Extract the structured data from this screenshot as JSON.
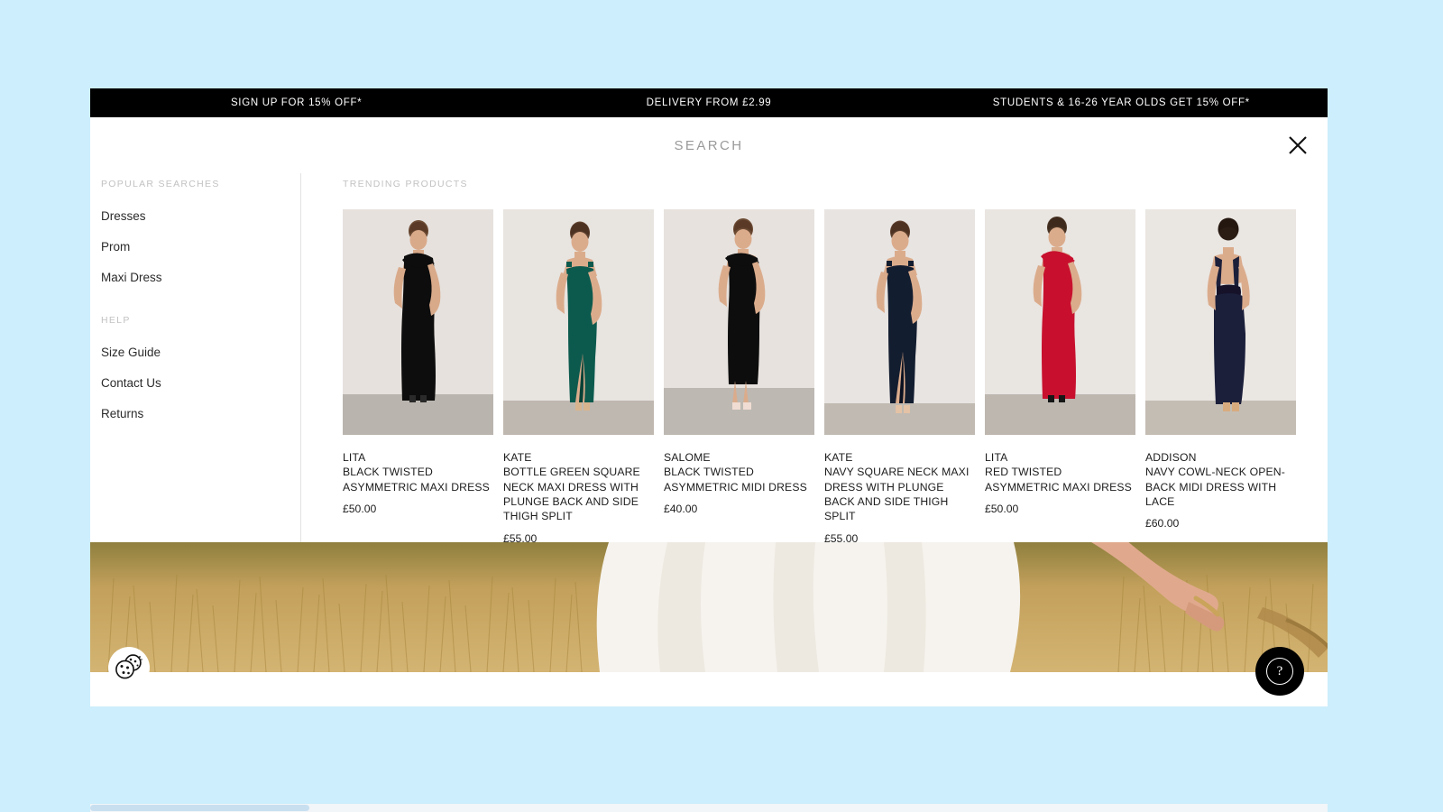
{
  "theme": {
    "page_background": "#cdeefc",
    "promo_background": "#000000",
    "promo_text": "#ffffff",
    "panel_background": "#ffffff",
    "heading_color": "#c2c2c2",
    "body_text": "#1c1c1c"
  },
  "promo_bar": {
    "items": [
      {
        "label": "SIGN UP FOR 15% OFF*"
      },
      {
        "label": "DELIVERY FROM £2.99"
      },
      {
        "label": "STUDENTS & 16-26 YEAR OLDS GET 15% OFF*"
      }
    ]
  },
  "search": {
    "placeholder": "SEARCH",
    "value": "",
    "close_icon": "close-icon"
  },
  "sidebar": {
    "popular_searches_heading": "POPULAR SEARCHES",
    "popular_searches": [
      {
        "label": "Dresses"
      },
      {
        "label": "Prom"
      },
      {
        "label": "Maxi Dress"
      }
    ],
    "help_heading": "HELP",
    "help_links": [
      {
        "label": "Size Guide"
      },
      {
        "label": "Contact Us"
      },
      {
        "label": "Returns"
      }
    ]
  },
  "trending": {
    "heading": "TRENDING PRODUCTS",
    "products": [
      {
        "name": "LITA",
        "title": "BLACK TWISTED ASYMMETRIC MAXI DRESS",
        "price": "£50.00",
        "dress_color": "#0d0d0d",
        "backdrop": "#e6e1dd",
        "silhouette": "maxi-one-shoulder"
      },
      {
        "name": "KATE",
        "title": "BOTTLE GREEN SQUARE NECK MAXI DRESS WITH PLUNGE BACK AND SIDE THIGH SPLIT",
        "price": "£55.00",
        "dress_color": "#0c5a4e",
        "backdrop": "#e8e4e0",
        "silhouette": "maxi-square-neck-split"
      },
      {
        "name": "SALOME",
        "title": "BLACK TWISTED ASYMMETRIC MIDI DRESS",
        "price": "£40.00",
        "dress_color": "#0d0d0d",
        "backdrop": "#e7e2de",
        "silhouette": "midi-one-shoulder"
      },
      {
        "name": "KATE",
        "title": "NAVY SQUARE NECK MAXI DRESS WITH PLUNGE BACK AND SIDE THIGH SPLIT",
        "price": "£55.00",
        "dress_color": "#131d30",
        "backdrop": "#e8e4e1",
        "silhouette": "maxi-square-neck-split"
      },
      {
        "name": "LITA",
        "title": "RED TWISTED ASYMMETRIC MAXI DRESS",
        "price": "£50.00",
        "dress_color": "#c8102e",
        "backdrop": "#e9e5e1",
        "silhouette": "maxi-one-shoulder"
      },
      {
        "name": "ADDISON",
        "title": "NAVY COWL-NECK OPEN-BACK MIDI DRESS WITH LACE",
        "price": "£60.00",
        "dress_color": "#1b1f3a",
        "backdrop": "#eae6e2",
        "silhouette": "midi-open-back"
      }
    ]
  },
  "hero": {
    "description": "woman in white dress walking through golden wheat field",
    "field_color": "#c5a059",
    "dress_color": "#f4f1ea"
  },
  "floating": {
    "cookie_label": "cookie-settings",
    "help_label": "?"
  }
}
